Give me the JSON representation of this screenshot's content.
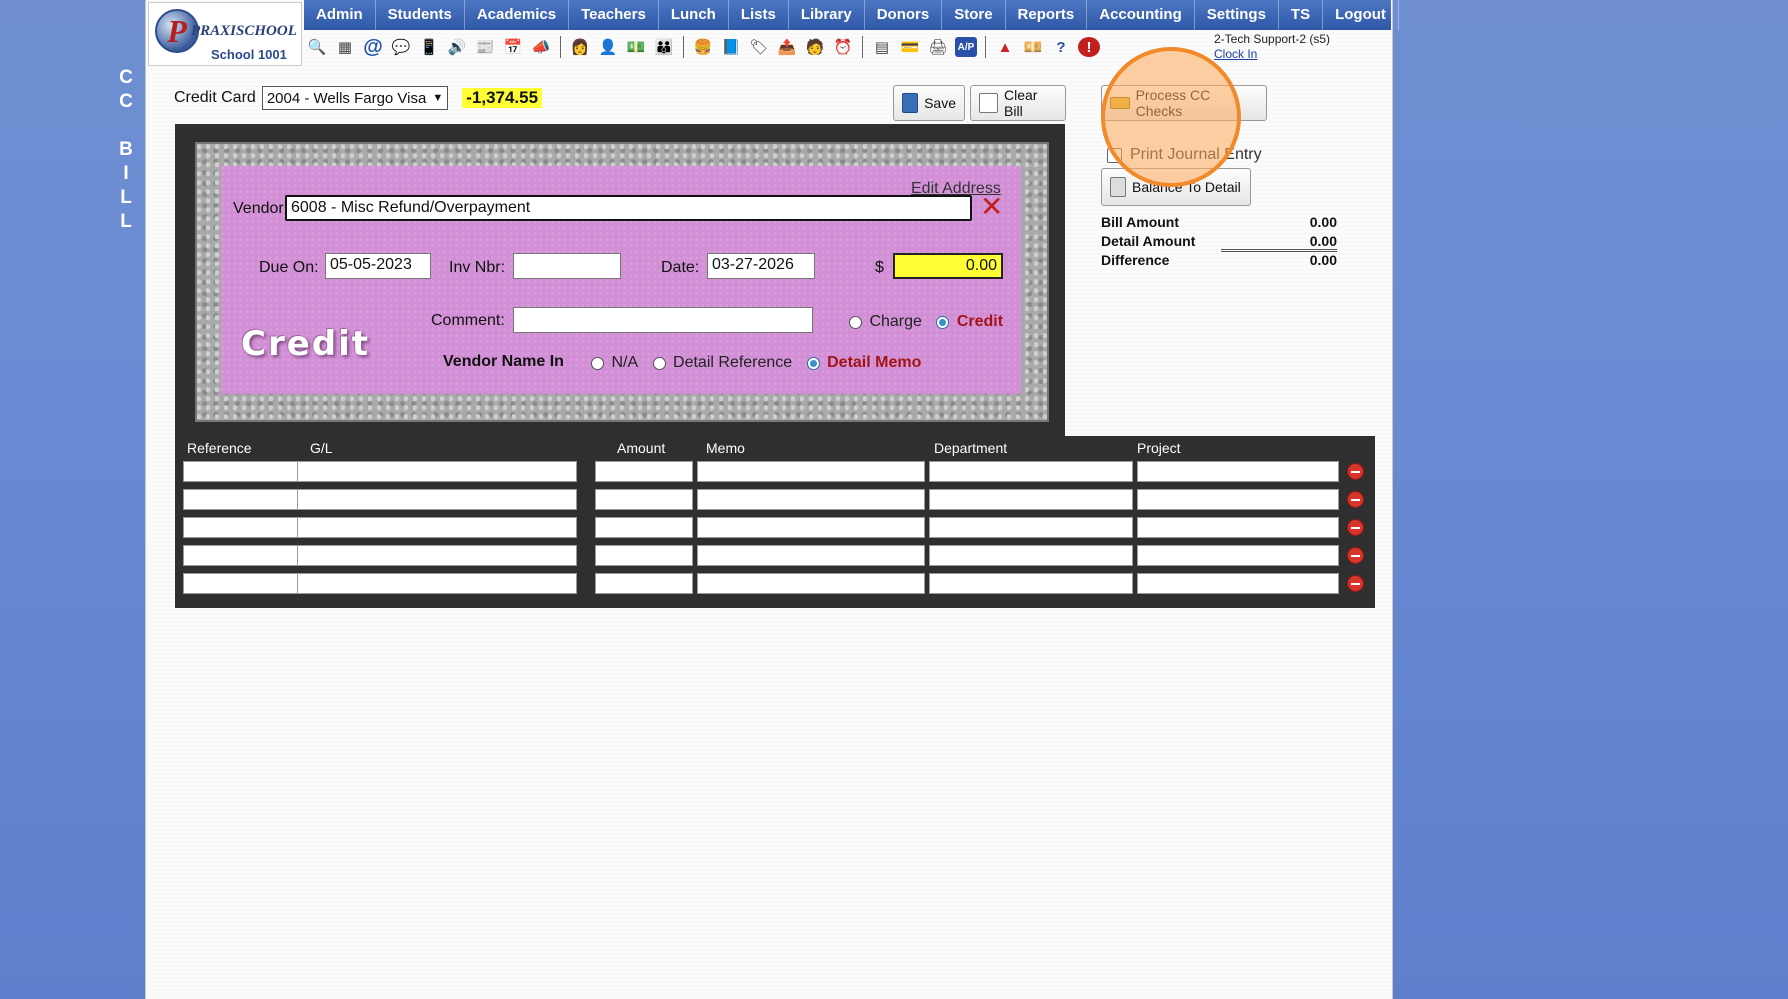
{
  "side_title": [
    "C",
    "C",
    "",
    "B",
    "I",
    "L",
    "L"
  ],
  "logo": {
    "name": "PRAXISCHOOL",
    "school": "School 1001",
    "tm": "™"
  },
  "nav": [
    "Admin",
    "Students",
    "Academics",
    "Teachers",
    "Lunch",
    "Lists",
    "Library",
    "Donors",
    "Store",
    "Reports",
    "Accounting",
    "Settings",
    "TS",
    "Logout"
  ],
  "toolbar_icons": [
    "search-icon",
    "calendar-icon",
    "email-icon",
    "chat-icon",
    "phone-icon",
    "speaker-icon",
    "newsletter-icon",
    "planner-icon",
    "megaphone-icon",
    "teacher-icon",
    "staff-icon",
    "money-icon",
    "parents-icon",
    "food-icon",
    "book-icon",
    "tag-icon",
    "transfer-icon",
    "person-icon",
    "clock-icon",
    "grid-icon",
    "card-icon",
    "printer-icon",
    "ap-icon",
    "pdf-icon",
    "cash-icon",
    "help-icon",
    "power-icon"
  ],
  "user": {
    "name": "2-Tech Support-2 (s5)",
    "clock_in": "Clock In"
  },
  "credit_card": {
    "label": "Credit Card",
    "selected": "2004 - Wells Fargo Visa",
    "balance": "-1,374.55"
  },
  "buttons": {
    "save": "Save",
    "clear": "Clear Bill",
    "process": "Process CC Checks",
    "balance_detail": "Balance To Detail"
  },
  "print_journal": "Print Journal Entry",
  "form": {
    "edit_address": "Edit Address",
    "vendor_label": "Vendor",
    "vendor_value": "6008 - Misc Refund/Overpayment",
    "due_label": "Due On:",
    "due_value": "05-05-2023",
    "inv_label": "Inv Nbr:",
    "inv_value": "",
    "date_label": "Date:",
    "date_value": "03-27-2026",
    "dollar": "$",
    "amount_value": "0.00",
    "comment_label": "Comment:",
    "comment_value": "",
    "charge": "Charge",
    "credit": "Credit",
    "credit_banner": "Credit",
    "vendor_name_in": "Vendor Name In",
    "opt_na": "N/A",
    "opt_ref": "Detail Reference",
    "opt_memo": "Detail Memo"
  },
  "summary": [
    {
      "label": "Bill Amount",
      "value": "0.00"
    },
    {
      "label": "Detail Amount",
      "value": "0.00"
    },
    {
      "label": "Difference",
      "value": "0.00"
    }
  ],
  "detail": {
    "columns": [
      "Reference",
      "G/L",
      "Amount",
      "Memo",
      "Department",
      "Project"
    ],
    "row_count": 5
  },
  "colors": {
    "nav": "#2f58a8",
    "lavender": "#d28fd6",
    "highlight": "#ffff33",
    "accent_red": "#a31515"
  }
}
